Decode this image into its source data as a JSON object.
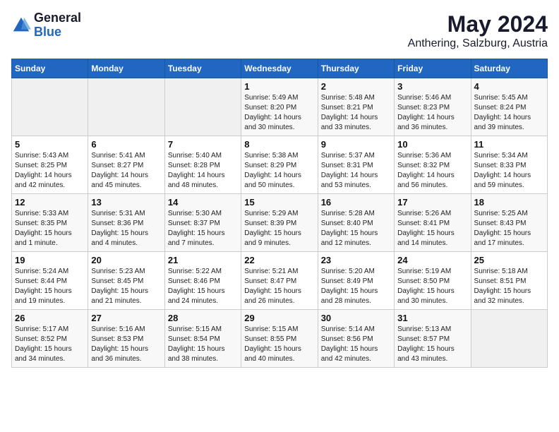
{
  "header": {
    "logo_line1": "General",
    "logo_line2": "Blue",
    "main_title": "May 2024",
    "subtitle": "Anthering, Salzburg, Austria"
  },
  "weekdays": [
    "Sunday",
    "Monday",
    "Tuesday",
    "Wednesday",
    "Thursday",
    "Friday",
    "Saturday"
  ],
  "weeks": [
    [
      {
        "num": "",
        "info": ""
      },
      {
        "num": "",
        "info": ""
      },
      {
        "num": "",
        "info": ""
      },
      {
        "num": "1",
        "info": "Sunrise: 5:49 AM\nSunset: 8:20 PM\nDaylight: 14 hours\nand 30 minutes."
      },
      {
        "num": "2",
        "info": "Sunrise: 5:48 AM\nSunset: 8:21 PM\nDaylight: 14 hours\nand 33 minutes."
      },
      {
        "num": "3",
        "info": "Sunrise: 5:46 AM\nSunset: 8:23 PM\nDaylight: 14 hours\nand 36 minutes."
      },
      {
        "num": "4",
        "info": "Sunrise: 5:45 AM\nSunset: 8:24 PM\nDaylight: 14 hours\nand 39 minutes."
      }
    ],
    [
      {
        "num": "5",
        "info": "Sunrise: 5:43 AM\nSunset: 8:25 PM\nDaylight: 14 hours\nand 42 minutes."
      },
      {
        "num": "6",
        "info": "Sunrise: 5:41 AM\nSunset: 8:27 PM\nDaylight: 14 hours\nand 45 minutes."
      },
      {
        "num": "7",
        "info": "Sunrise: 5:40 AM\nSunset: 8:28 PM\nDaylight: 14 hours\nand 48 minutes."
      },
      {
        "num": "8",
        "info": "Sunrise: 5:38 AM\nSunset: 8:29 PM\nDaylight: 14 hours\nand 50 minutes."
      },
      {
        "num": "9",
        "info": "Sunrise: 5:37 AM\nSunset: 8:31 PM\nDaylight: 14 hours\nand 53 minutes."
      },
      {
        "num": "10",
        "info": "Sunrise: 5:36 AM\nSunset: 8:32 PM\nDaylight: 14 hours\nand 56 minutes."
      },
      {
        "num": "11",
        "info": "Sunrise: 5:34 AM\nSunset: 8:33 PM\nDaylight: 14 hours\nand 59 minutes."
      }
    ],
    [
      {
        "num": "12",
        "info": "Sunrise: 5:33 AM\nSunset: 8:35 PM\nDaylight: 15 hours\nand 1 minute."
      },
      {
        "num": "13",
        "info": "Sunrise: 5:31 AM\nSunset: 8:36 PM\nDaylight: 15 hours\nand 4 minutes."
      },
      {
        "num": "14",
        "info": "Sunrise: 5:30 AM\nSunset: 8:37 PM\nDaylight: 15 hours\nand 7 minutes."
      },
      {
        "num": "15",
        "info": "Sunrise: 5:29 AM\nSunset: 8:39 PM\nDaylight: 15 hours\nand 9 minutes."
      },
      {
        "num": "16",
        "info": "Sunrise: 5:28 AM\nSunset: 8:40 PM\nDaylight: 15 hours\nand 12 minutes."
      },
      {
        "num": "17",
        "info": "Sunrise: 5:26 AM\nSunset: 8:41 PM\nDaylight: 15 hours\nand 14 minutes."
      },
      {
        "num": "18",
        "info": "Sunrise: 5:25 AM\nSunset: 8:43 PM\nDaylight: 15 hours\nand 17 minutes."
      }
    ],
    [
      {
        "num": "19",
        "info": "Sunrise: 5:24 AM\nSunset: 8:44 PM\nDaylight: 15 hours\nand 19 minutes."
      },
      {
        "num": "20",
        "info": "Sunrise: 5:23 AM\nSunset: 8:45 PM\nDaylight: 15 hours\nand 21 minutes."
      },
      {
        "num": "21",
        "info": "Sunrise: 5:22 AM\nSunset: 8:46 PM\nDaylight: 15 hours\nand 24 minutes."
      },
      {
        "num": "22",
        "info": "Sunrise: 5:21 AM\nSunset: 8:47 PM\nDaylight: 15 hours\nand 26 minutes."
      },
      {
        "num": "23",
        "info": "Sunrise: 5:20 AM\nSunset: 8:49 PM\nDaylight: 15 hours\nand 28 minutes."
      },
      {
        "num": "24",
        "info": "Sunrise: 5:19 AM\nSunset: 8:50 PM\nDaylight: 15 hours\nand 30 minutes."
      },
      {
        "num": "25",
        "info": "Sunrise: 5:18 AM\nSunset: 8:51 PM\nDaylight: 15 hours\nand 32 minutes."
      }
    ],
    [
      {
        "num": "26",
        "info": "Sunrise: 5:17 AM\nSunset: 8:52 PM\nDaylight: 15 hours\nand 34 minutes."
      },
      {
        "num": "27",
        "info": "Sunrise: 5:16 AM\nSunset: 8:53 PM\nDaylight: 15 hours\nand 36 minutes."
      },
      {
        "num": "28",
        "info": "Sunrise: 5:15 AM\nSunset: 8:54 PM\nDaylight: 15 hours\nand 38 minutes."
      },
      {
        "num": "29",
        "info": "Sunrise: 5:15 AM\nSunset: 8:55 PM\nDaylight: 15 hours\nand 40 minutes."
      },
      {
        "num": "30",
        "info": "Sunrise: 5:14 AM\nSunset: 8:56 PM\nDaylight: 15 hours\nand 42 minutes."
      },
      {
        "num": "31",
        "info": "Sunrise: 5:13 AM\nSunset: 8:57 PM\nDaylight: 15 hours\nand 43 minutes."
      },
      {
        "num": "",
        "info": ""
      }
    ]
  ]
}
